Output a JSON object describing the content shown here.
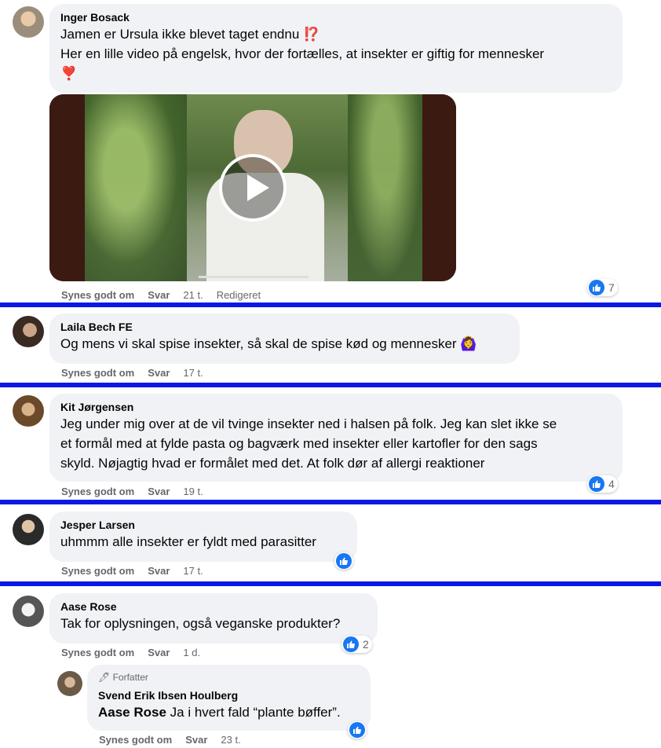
{
  "comments": [
    {
      "author": "Inger Bosack",
      "lines": [
        "Jamen er Ursula ikke blevet taget endnu ⁉️",
        "Her en lille video på engelsk, hvor der fortælles, at insekter er giftig for mennesker",
        "❣️"
      ],
      "like": "Synes godt om",
      "reply": "Svar",
      "time": "21 t.",
      "edited": "Redigeret",
      "reactions": "7"
    },
    {
      "author": "Laila Bech FE",
      "lines": [
        "Og mens vi skal spise insekter, så skal de spise kød og mennesker 🙆‍♀️"
      ],
      "like": "Synes godt om",
      "reply": "Svar",
      "time": "17 t."
    },
    {
      "author": "Kit Jørgensen",
      "lines": [
        "Jeg under mig over at de vil tvinge insekter ned i halsen på folk. Jeg kan slet ikke se",
        "et formål med at fylde pasta og bagværk med insekter eller kartofler for den sags",
        "skyld. Nøjagtig hvad er formålet med det. At folk dør af allergi reaktioner"
      ],
      "like": "Synes godt om",
      "reply": "Svar",
      "time": "19 t.",
      "reactions": "4"
    },
    {
      "author": "Jesper Larsen",
      "lines": [
        "uhmmm alle insekter er fyldt med parasitter"
      ],
      "like": "Synes godt om",
      "reply": "Svar",
      "time": "17 t."
    },
    {
      "author": "Aase Rose",
      "lines": [
        "Tak for oplysningen, også veganske produkter?"
      ],
      "like": "Synes godt om",
      "reply": "Svar",
      "time": "1 d.",
      "reactions": "2"
    }
  ],
  "reply": {
    "badge": "Forfatter",
    "author": "Svend Erik Ibsen Houlberg",
    "mention": "Aase Rose",
    "text": "Ja i hvert fald “plante bøffer”.",
    "like": "Synes godt om",
    "reply": "Svar",
    "time": "23 t."
  },
  "colors": {
    "divider": "#0a18e6",
    "like_blue": "#1877f2",
    "bubble": "#f0f2f5",
    "meta": "#65676b"
  }
}
